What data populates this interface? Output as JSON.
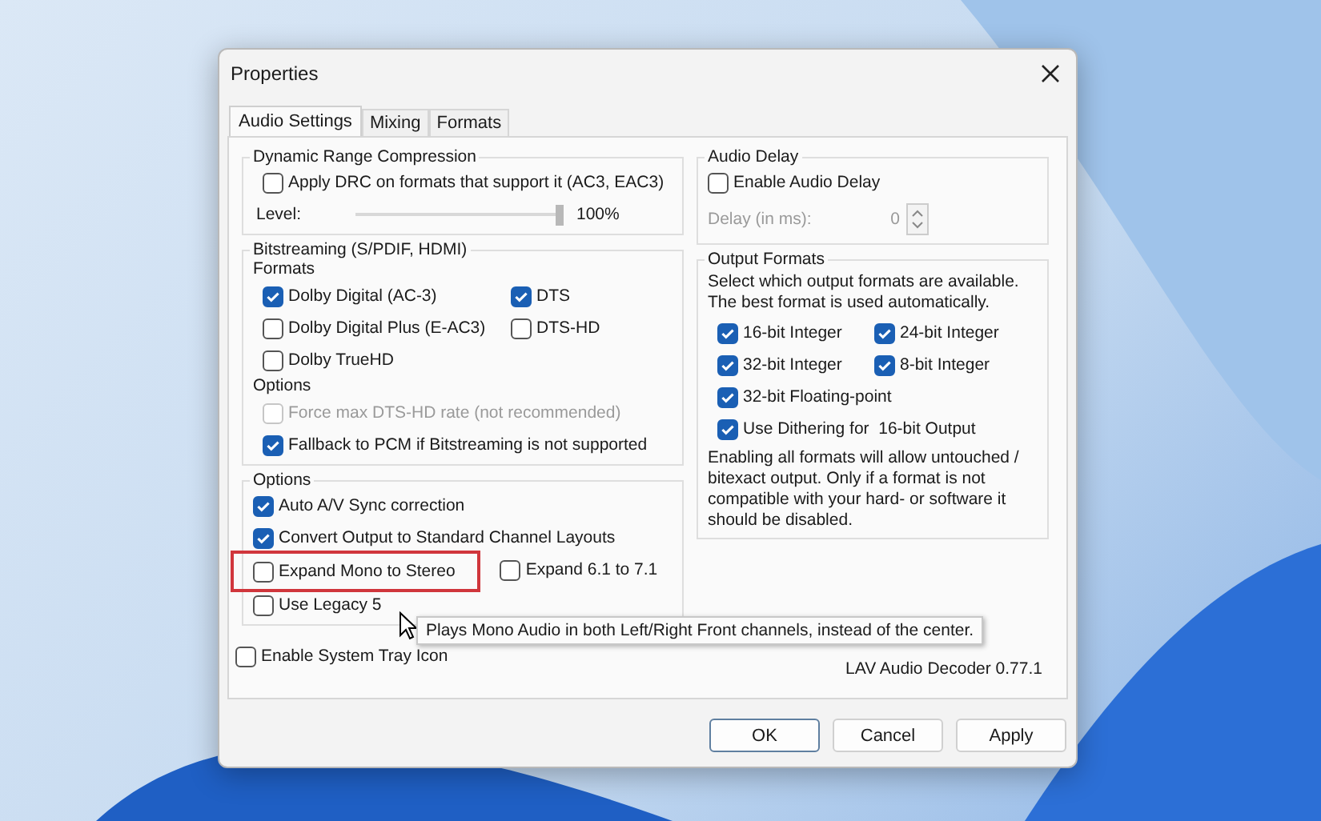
{
  "window": {
    "title": "Properties"
  },
  "tabs": [
    {
      "label": "Audio Settings",
      "selected": true
    },
    {
      "label": "Mixing",
      "selected": false
    },
    {
      "label": "Formats",
      "selected": false
    }
  ],
  "drc": {
    "title": "Dynamic Range Compression",
    "checkbox": {
      "label": "Apply DRC on formats that support it (AC3, EAC3)",
      "checked": false
    },
    "level_label": "Level:",
    "slider": {
      "level": 1
    },
    "reading": "100%"
  },
  "bitstreaming": {
    "title": "Bitstreaming (S/PDIF, HDMI)",
    "formats_label": "Formats",
    "formats": [
      {
        "label": "Dolby Digital (AC-3)",
        "checked": true
      },
      {
        "label": "DTS",
        "checked": true
      },
      {
        "label": "Dolby Digital Plus (E-AC3)",
        "checked": false
      },
      {
        "label": "DTS-HD",
        "checked": false
      },
      {
        "label": "Dolby TrueHD",
        "checked": false
      }
    ],
    "options_label": "Options",
    "options": [
      {
        "label": "Force max DTS-HD rate (not recommended)",
        "checked": false,
        "disabled": true
      },
      {
        "label": "Fallback to PCM if Bitstreaming is not supported",
        "checked": true,
        "disabled": false
      }
    ]
  },
  "options": {
    "title": "Options",
    "rows": [
      [
        {
          "label": "Auto A/V Sync correction",
          "checked": true,
          "highlighted": false
        }
      ],
      [
        {
          "label": "Convert Output to Standard Channel Layouts",
          "checked": true,
          "highlighted": false
        }
      ],
      [
        {
          "label": "Expand Mono to Stereo",
          "checked": false,
          "highlighted": true
        },
        {
          "label": "Expand 6.1 to 7.1",
          "checked": false,
          "highlighted": false
        }
      ],
      [
        {
          "label": "Use Legacy 5",
          "checked": false,
          "highlighted": false
        }
      ]
    ]
  },
  "tray": {
    "label": "Enable System Tray Icon",
    "checked": false
  },
  "audio_delay": {
    "title": "Audio Delay",
    "checkbox": {
      "label": "Enable Audio Delay",
      "checked": false
    },
    "delay_label": "Delay (in ms):",
    "value": "0"
  },
  "output_formats": {
    "title": "Output Formats",
    "description": "Select which output formats are available. The best format is used automatically.",
    "formats": [
      {
        "label": "16-bit Integer",
        "checked": true
      },
      {
        "label": "24-bit Integer",
        "checked": true
      },
      {
        "label": "32-bit Integer",
        "checked": true
      },
      {
        "label": "8-bit Integer",
        "checked": true
      },
      {
        "label": "32-bit Floating-point",
        "checked": true
      }
    ],
    "dithering": {
      "label": "Use Dithering for  16-bit Output",
      "checked": true
    },
    "note": "Enabling all formats will allow untouched / bitexact output. Only if a format is not compatible with your hard- or software it should be disabled."
  },
  "version": "LAV Audio Decoder 0.77.1",
  "buttons": [
    {
      "label": "OK",
      "default": true
    },
    {
      "label": "Cancel",
      "default": false
    },
    {
      "label": "Apply",
      "default": false
    }
  ],
  "tooltip": {
    "text": "Plays Mono Audio in both Left/Right Front channels, instead of the center."
  }
}
